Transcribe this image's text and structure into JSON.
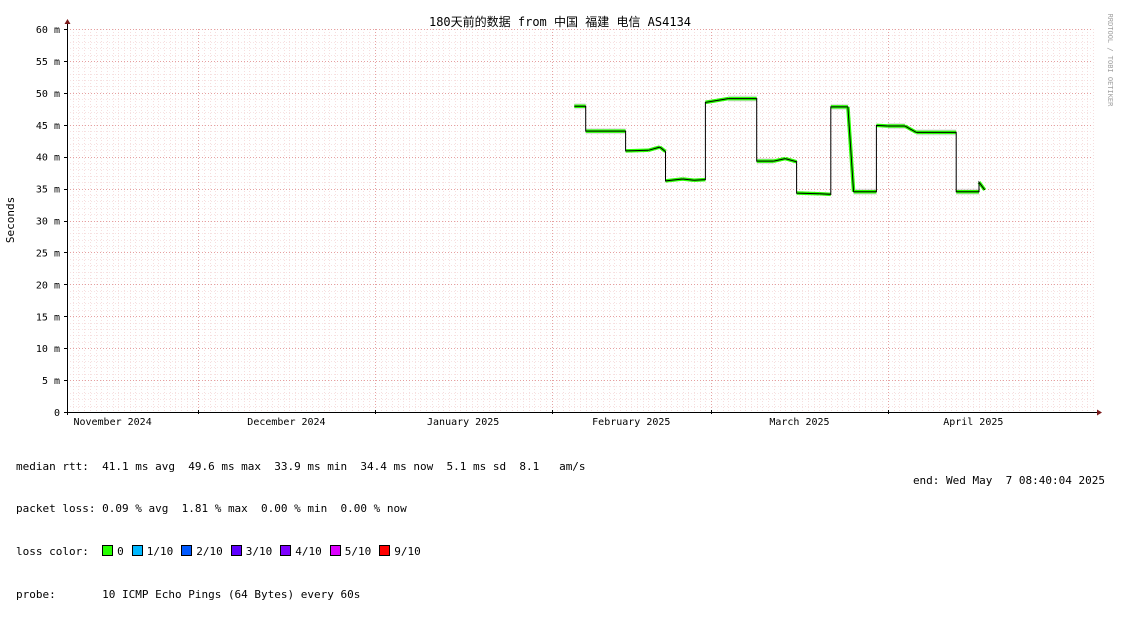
{
  "chart_data": {
    "type": "line",
    "title": "180天前的数据 from 中国 福建 电信 AS4134",
    "ylabel": "Seconds",
    "watermark": "RRDTOOL / TOBI OETIKER",
    "y_ticks": [
      "0",
      "5 m",
      "10 m",
      "15 m",
      "20 m",
      "25 m",
      "30 m",
      "35 m",
      "40 m",
      "45 m",
      "50 m",
      "55 m",
      "60 m"
    ],
    "ylim": [
      0,
      60
    ],
    "xlim": [
      "2024-11-08",
      "2025-05-07"
    ],
    "x_ticks": [
      {
        "date": "2024-11-01",
        "label": "November 2024"
      },
      {
        "date": "2024-12-01",
        "label": "December 2024"
      },
      {
        "date": "2025-01-01",
        "label": "January 2025"
      },
      {
        "date": "2025-02-01",
        "label": "February 2025"
      },
      {
        "date": "2025-03-01",
        "label": "March 2025"
      },
      {
        "date": "2025-04-01",
        "label": "April 2025"
      }
    ],
    "series": [
      {
        "unit": "ms",
        "points": [
          [
            "2025-02-05",
            47.9
          ],
          [
            "2025-02-07",
            47.9
          ],
          [
            "2025-02-07",
            44.0
          ],
          [
            "2025-02-14",
            44.0
          ],
          [
            "2025-02-14",
            40.9
          ],
          [
            "2025-02-18",
            41.0
          ],
          [
            "2025-02-20",
            41.5
          ],
          [
            "2025-02-21",
            40.8
          ],
          [
            "2025-02-21",
            36.2
          ],
          [
            "2025-02-24",
            36.5
          ],
          [
            "2025-02-26",
            36.3
          ],
          [
            "2025-02-28",
            36.4
          ],
          [
            "2025-02-28",
            48.5
          ],
          [
            "2025-03-02",
            48.8
          ],
          [
            "2025-03-04",
            49.1
          ],
          [
            "2025-03-09",
            49.1
          ],
          [
            "2025-03-09",
            39.3
          ],
          [
            "2025-03-12",
            39.3
          ],
          [
            "2025-03-14",
            39.7
          ],
          [
            "2025-03-16",
            39.2
          ],
          [
            "2025-03-16",
            34.3
          ],
          [
            "2025-03-20",
            34.2
          ],
          [
            "2025-03-22",
            34.1
          ],
          [
            "2025-03-22",
            47.8
          ],
          [
            "2025-03-25",
            47.8
          ],
          [
            "2025-03-26",
            34.5
          ],
          [
            "2025-03-30",
            34.5
          ],
          [
            "2025-03-30",
            44.9
          ],
          [
            "2025-04-01",
            44.8
          ],
          [
            "2025-04-04",
            44.8
          ],
          [
            "2025-04-06",
            43.8
          ],
          [
            "2025-04-13",
            43.8
          ],
          [
            "2025-04-13",
            34.5
          ],
          [
            "2025-04-17",
            34.5
          ],
          [
            "2025-04-17",
            36.0
          ],
          [
            "2025-04-18",
            34.8
          ]
        ]
      }
    ],
    "loss_colors": [
      {
        "label": "0",
        "color": "#26ff00"
      },
      {
        "label": "1/10",
        "color": "#00b8ff"
      },
      {
        "label": "2/10",
        "color": "#0059ff"
      },
      {
        "label": "3/10",
        "color": "#5e00ff"
      },
      {
        "label": "4/10",
        "color": "#7e00ff"
      },
      {
        "label": "5/10",
        "color": "#dd00ff"
      },
      {
        "label": "9/10",
        "color": "#ff0000"
      }
    ],
    "grid": true
  },
  "stats": {
    "median_label": "median rtt:",
    "median_values": "41.1 ms avg  49.6 ms max  33.9 ms min  34.4 ms now  5.1 ms sd  8.1   am/s",
    "loss_label": "packet loss:",
    "loss_values": "0.09 % avg  1.81 % max  0.00 % min  0.00 % now",
    "color_label": "loss color:",
    "probe_label": "probe:",
    "probe_value": "10 ICMP Echo Pings (64 Bytes) every 60s",
    "end_text": "end: Wed May  7 08:40:04 2025"
  }
}
